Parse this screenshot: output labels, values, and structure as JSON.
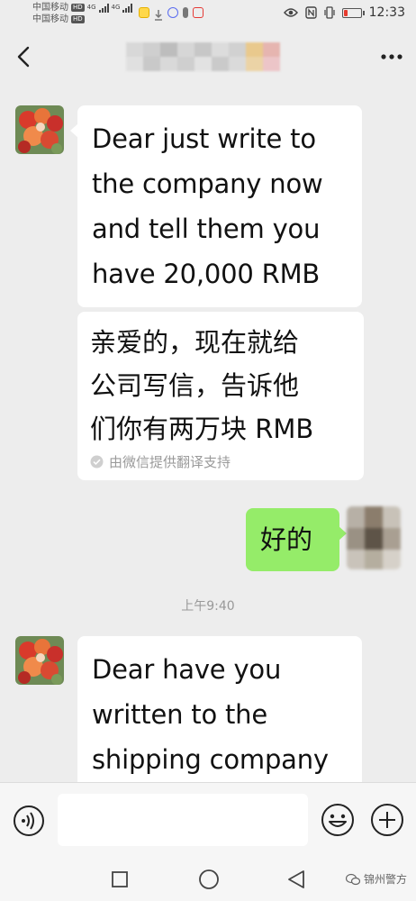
{
  "status_bar": {
    "carrier1": "中国移动",
    "carrier2": "中国移动",
    "hd": "HD",
    "network": "4G",
    "time": "12:33"
  },
  "header": {
    "back_icon": "chevron-left-icon",
    "title_redacted": true,
    "more_icon": "more-dots-icon"
  },
  "messages": [
    {
      "side": "left",
      "lines": [
        "Dear just write to",
        "the company now",
        "and tell them you",
        "have 20,000 RMB"
      ]
    },
    {
      "side": "left",
      "kind": "translation",
      "lines": [
        "亲爱的，现在就给",
        "公司写信，告诉他",
        "们你有两万块 RMB"
      ],
      "note": "由微信提供翻译支持"
    },
    {
      "side": "right",
      "lines": [
        "好的"
      ]
    },
    {
      "kind": "timestamp",
      "text": "上午9:40"
    },
    {
      "side": "left",
      "lines": [
        "Dear have you",
        "written to the",
        "shipping company"
      ]
    }
  ],
  "input_bar": {
    "voice_icon": "voice-icon",
    "placeholder": "",
    "emoji_icon": "emoji-icon",
    "plus_icon": "plus-icon"
  },
  "nav_bar": {
    "recent_icon": "square-icon",
    "home_icon": "circle-icon",
    "back_icon": "triangle-back-icon"
  },
  "watermark": {
    "text": "锦州警方"
  },
  "colors": {
    "background": "#ededed",
    "bubble_sent": "#95ec69",
    "bubble_received": "#ffffff"
  }
}
